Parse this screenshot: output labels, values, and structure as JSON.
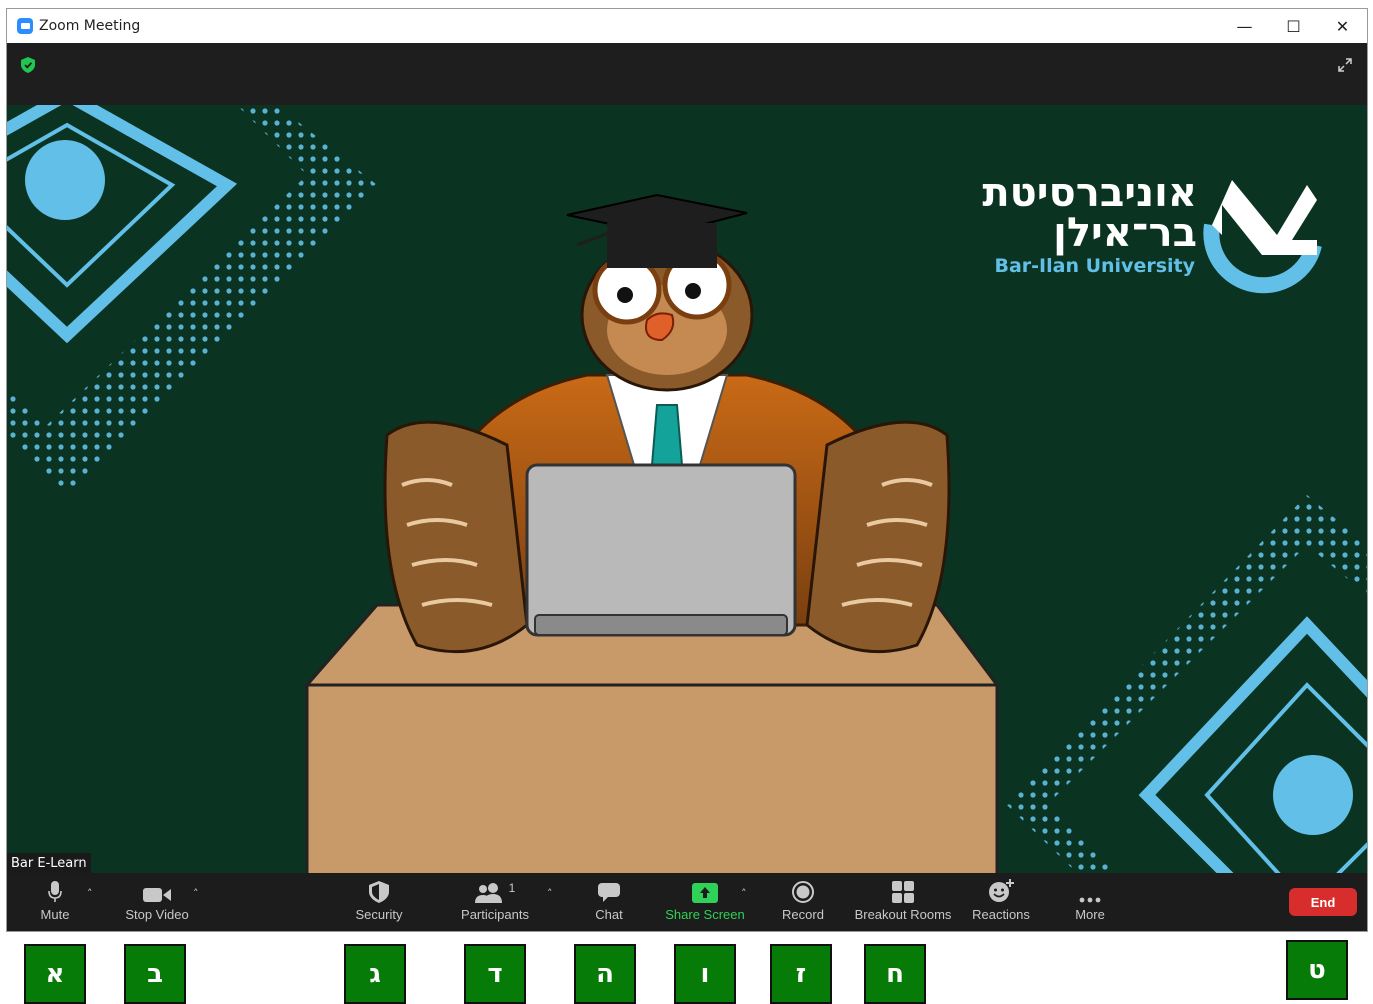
{
  "window": {
    "title": "Zoom Meeting",
    "minimize": "—",
    "maximize": "☐",
    "close": "✕"
  },
  "meeting": {
    "participant_name": "Bar E-Learn"
  },
  "background": {
    "logo_hebrew_line1": "אוניברסיטת",
    "logo_hebrew_line2": "בר־אילן",
    "logo_english": "Bar-Ilan University",
    "accent_color": "#62c0e8",
    "bg_color": "#0a3321"
  },
  "toolbar": {
    "mute": "Mute",
    "stop_video": "Stop Video",
    "security": "Security",
    "participants": "Participants",
    "participants_count": "1",
    "chat": "Chat",
    "share_screen": "Share Screen",
    "record": "Record",
    "breakout_rooms": "Breakout Rooms",
    "reactions": "Reactions",
    "more": "More",
    "end": "End",
    "caret": "˄"
  },
  "annotation_labels": [
    "א",
    "ב",
    "ג",
    "ד",
    "ה",
    "ו",
    "ז",
    "ח",
    "ט"
  ],
  "colors": {
    "share_green": "#2fd158",
    "end_red": "#d72d2d",
    "label_green": "#077b07"
  }
}
